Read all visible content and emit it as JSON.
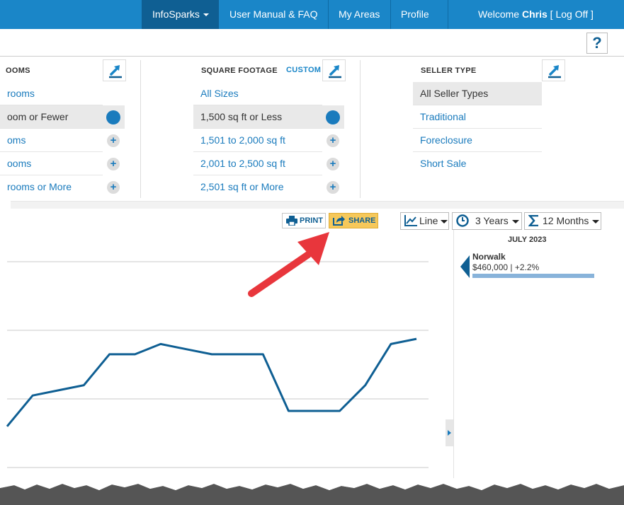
{
  "nav": {
    "infosparks": "InfoSparks",
    "manual": "User Manual & FAQ",
    "areas": "My Areas",
    "profile": "Profile",
    "welcome_prefix": "Welcome ",
    "user": "Chris",
    "logoff": " [ Log Off ]"
  },
  "help": {
    "label": "?"
  },
  "filters": {
    "bedrooms": {
      "title": "OOMS",
      "options": [
        {
          "label": "rooms",
          "selected": false
        },
        {
          "label": "oom or Fewer",
          "selected": true
        },
        {
          "label": "oms",
          "selected": false
        },
        {
          "label": "ooms",
          "selected": false
        },
        {
          "label": "rooms or More",
          "selected": false
        }
      ]
    },
    "square_footage": {
      "title": "SQUARE FOOTAGE",
      "custom": "CUSTOM",
      "options": [
        {
          "label": "All Sizes",
          "selected": false
        },
        {
          "label": "1,500 sq ft or Less",
          "selected": true
        },
        {
          "label": "1,501 to 2,000 sq ft",
          "selected": false
        },
        {
          "label": "2,001 to 2,500 sq ft",
          "selected": false
        },
        {
          "label": "2,501 sq ft or More",
          "selected": false
        }
      ]
    },
    "seller_type": {
      "title": "SELLER TYPE",
      "options": [
        {
          "label": "All Seller Types",
          "selected": true
        },
        {
          "label": "Traditional",
          "selected": false
        },
        {
          "label": "Foreclosure",
          "selected": false
        },
        {
          "label": "Short Sale",
          "selected": false
        }
      ]
    }
  },
  "toolbar": {
    "print": "PRINT",
    "share": "SHARE",
    "chart_type": "Line",
    "period": "3 Years",
    "rolling": "12 Months"
  },
  "legend": {
    "date": "JULY 2023",
    "name": "Norwalk",
    "value": "$460,000 | +2.2%"
  },
  "colors": {
    "nav": "#1a86c8",
    "nav_active": "#0f5f93",
    "line": "#0f5f93",
    "share": "#f6c85a",
    "annotation_arrow": "#e8363c"
  },
  "chart_data": {
    "type": "line",
    "title": "",
    "xlabel": "",
    "ylabel": "",
    "grid": true,
    "series": [
      {
        "values": [
          424,
          427,
          427.5,
          428,
          431,
          431,
          432,
          431.5,
          431,
          431,
          431,
          425.5,
          425.5,
          425.5,
          428,
          432,
          432.5
        ]
      }
    ]
  }
}
